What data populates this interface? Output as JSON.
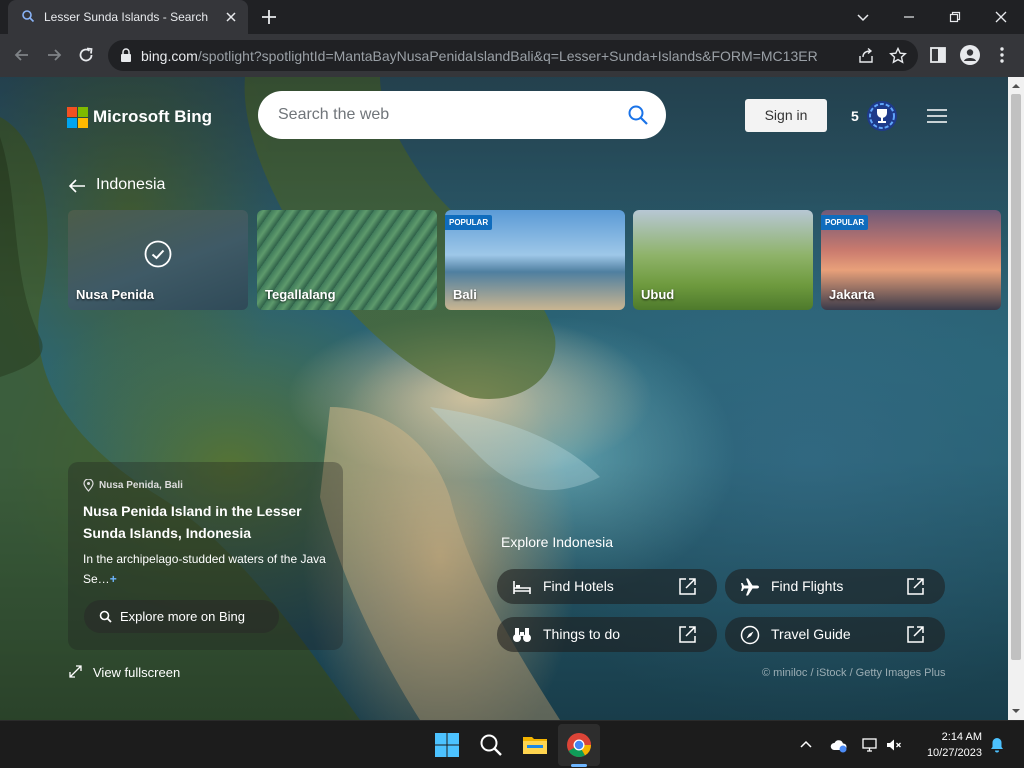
{
  "browser": {
    "tab_title": "Lesser Sunda Islands - Search",
    "url_host": "bing.com",
    "url_path": "/spotlight?spotlightId=MantaBayNusaPenidaIslandBali&q=Lesser+Sunda+Islands&FORM=MC13ER"
  },
  "header": {
    "brand": "Microsoft Bing",
    "search_placeholder": "Search the web",
    "signin_label": "Sign in",
    "rewards_count": "5"
  },
  "navigation": {
    "back_label": "Indonesia"
  },
  "destinations": [
    {
      "name": "Nusa Penida",
      "badge": "",
      "selected": true
    },
    {
      "name": "Tegallalang",
      "badge": "",
      "selected": false
    },
    {
      "name": "Bali",
      "badge": "POPULAR",
      "selected": false
    },
    {
      "name": "Ubud",
      "badge": "",
      "selected": false
    },
    {
      "name": "Jakarta",
      "badge": "POPULAR",
      "selected": false
    }
  ],
  "info": {
    "location": "Nusa Penida, Bali",
    "title": "Nusa Penida Island in the Lesser Sunda Islands, Indonesia",
    "description": "In the archipelago-studded waters of the Java Se…",
    "more_symbol": "+",
    "explore_label": "Explore more on Bing"
  },
  "fullscreen_label": "View fullscreen",
  "explore": {
    "heading": "Explore Indonesia",
    "actions": [
      {
        "label": "Find Hotels",
        "icon": "bed-icon"
      },
      {
        "label": "Find Flights",
        "icon": "airplane-icon"
      },
      {
        "label": "Things to do",
        "icon": "binoculars-icon"
      },
      {
        "label": "Travel Guide",
        "icon": "compass-icon"
      }
    ]
  },
  "credit": "© miniloc / iStock / Getty Images Plus",
  "taskbar": {
    "time": "2:14 AM",
    "date": "10/27/2023"
  },
  "colors": {
    "accent": "#0f6cbd",
    "chrome_dark": "#202124",
    "chrome_toolbar": "#35363a"
  }
}
